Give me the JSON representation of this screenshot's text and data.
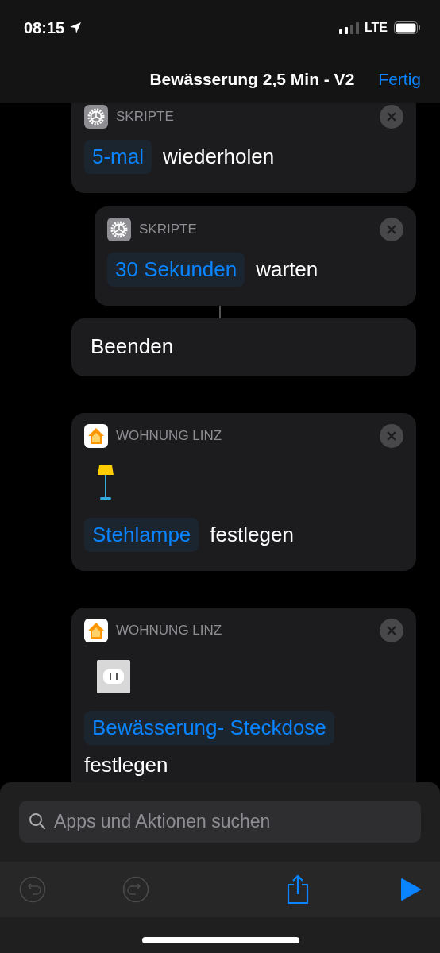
{
  "status_bar": {
    "time": "08:15",
    "network": "LTE"
  },
  "nav": {
    "title": "Bewässerung 2,5 Min - V2",
    "done": "Fertig"
  },
  "actions": [
    {
      "kind": "scripts",
      "category": "SKRIPTE",
      "param": "5-mal",
      "verb": "wiederholen",
      "children": [
        {
          "kind": "scripts",
          "category": "SKRIPTE",
          "param": "30 Sekunden",
          "verb": "warten"
        }
      ],
      "end": "Beenden"
    },
    {
      "kind": "home",
      "category": "WOHNUNG LINZ",
      "device": {
        "kind": "lamp"
      },
      "param": "Stehlampe",
      "verb": "festlegen"
    },
    {
      "kind": "home",
      "category": "WOHNUNG LINZ",
      "device": {
        "kind": "outlet"
      },
      "param": "Bewässerung- Steckdose",
      "verb": "festlegen"
    }
  ],
  "search": {
    "placeholder": "Apps und Aktionen suchen"
  },
  "toolbar": [
    {
      "kind": "undo",
      "disabled": true
    },
    {
      "kind": "redo",
      "disabled": true
    },
    {
      "kind": "share",
      "disabled": false
    },
    {
      "kind": "run",
      "disabled": false
    }
  ]
}
